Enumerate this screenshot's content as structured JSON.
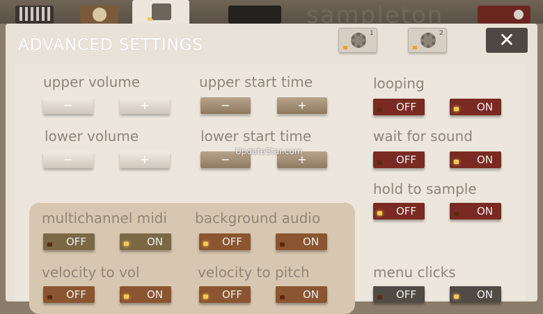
{
  "app": {
    "name": "sampleton"
  },
  "top_tabs": {
    "active": "settings"
  },
  "dialog": {
    "title": "ADVANCED SETTINGS",
    "gear1_sub": "1",
    "gear2_sub": "2",
    "close_label": "✕"
  },
  "volume": {
    "upper_label": "upper volume",
    "lower_label": "lower volume",
    "upper_start_label": "upper start time",
    "lower_start_label": "lower start time",
    "minus": "−",
    "plus": "+"
  },
  "toggles": {
    "off": "OFF",
    "on": "ON",
    "looping": {
      "label": "looping",
      "state": "ON"
    },
    "wait_for_sound": {
      "label": "wait for sound",
      "state": "ON"
    },
    "hold_to_sample": {
      "label": "hold to sample",
      "state": "OFF"
    },
    "menu_clicks": {
      "label": "menu clicks",
      "state": "ON"
    },
    "multichannel_midi": {
      "label": "multichannel midi",
      "state": "ON"
    },
    "background_audio": {
      "label": "background audio",
      "state": "OFF"
    },
    "velocity_to_vol": {
      "label": "velocity to vol",
      "state": "ON"
    },
    "velocity_to_pitch": {
      "label": "velocity to pitch",
      "state": "OFF"
    }
  },
  "watermark": "UpdateStar.com",
  "colors": {
    "red": "#7a2a22",
    "brown": "#8a5530",
    "olive": "#7b6845",
    "dark": "#504b45",
    "led_on": "#f9c850"
  }
}
